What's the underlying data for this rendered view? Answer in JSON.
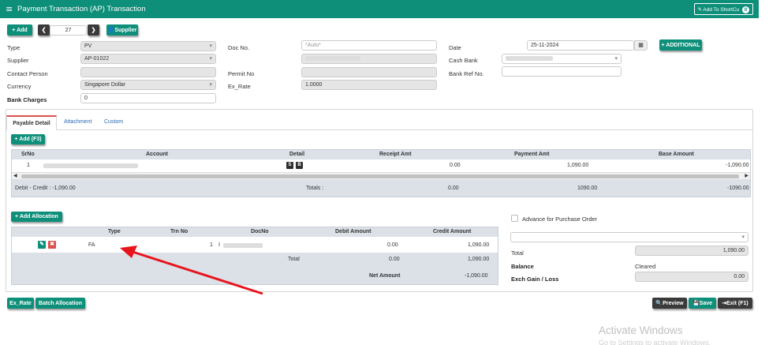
{
  "header": {
    "title": "Payment Transaction (AP) Transaction",
    "shortcut_label": "Add To ShortCu",
    "shortcut_badge": "0"
  },
  "toolbar": {
    "add_label": "+ Add",
    "record_no": "27",
    "supplier_label": "Supplier",
    "additional_label": "+ ADDITIONAL"
  },
  "form": {
    "type_label": "Type",
    "type_value": "PV",
    "supplier_label": "Supplier",
    "supplier_value": "AP-01022",
    "contact_label": "Contact Person",
    "contact_value": "",
    "currency_label": "Currency",
    "currency_value": "Singapore Dollar",
    "bank_charges_label": "Bank Charges",
    "bank_charges_value": "0",
    "docno_label": "Doc No.",
    "docno_placeholder": "*Auto*",
    "permit_label": "Permit No",
    "permit_value": "",
    "exrate_label": "Ex_Rate",
    "exrate_value": "1.0000",
    "date_label": "Date",
    "date_value": "25-11-2024",
    "cashbank_label": "Cash Bank",
    "bankref_label": "Bank Ref No.",
    "bankref_value": ""
  },
  "tabs": [
    {
      "label": "Payable Detail"
    },
    {
      "label": "Attachment"
    },
    {
      "label": "Custom"
    }
  ],
  "detail": {
    "add_label": "+ Add (F3)",
    "columns": [
      "SrNo",
      "Account",
      "Detail",
      "Receipt Amt",
      "Payment Amt",
      "Base Amount"
    ],
    "rows": [
      {
        "srno": "1",
        "detail_s": "S",
        "detail_b": "B",
        "receipt": "0.00",
        "payment": "1,090.00",
        "base": "-1,090.00"
      }
    ],
    "summary": {
      "debit_credit": "Debit - Credit : -1,090.00",
      "totals_label": "Totals :",
      "receipt": "0.00",
      "payment": "1090.00",
      "base": "-1090.00"
    }
  },
  "allocation": {
    "add_label": "+ Add Allocation",
    "columns": [
      "Type",
      "Trn No",
      "DocNo",
      "Debit Amount",
      "Credit Amount"
    ],
    "rows": [
      {
        "type": "FA",
        "trn_no": "1",
        "docno": "I",
        "debit": "0.00",
        "credit": "1,090.00"
      }
    ],
    "total_label": "Total",
    "total_debit": "0.00",
    "total_credit": "1,090.00",
    "net_label": "Net Amount",
    "net_value": "-1,090.00"
  },
  "side": {
    "advance_label": "Advance for Purchase Order",
    "total_label": "Total",
    "total_value": "1,090.00",
    "balance_label": "Balance",
    "balance_value": "Cleared",
    "exch_label": "Exch Gain / Loss",
    "exch_value": "0.00"
  },
  "footer": {
    "exrate_label": "Ex_Rate",
    "batch_label": "Batch Allocation",
    "preview_label": "Preview",
    "save_label": "Save",
    "exit_label": "Exit (F1)"
  },
  "watermark": {
    "line1": "Activate Windows",
    "line2": "Go to Settings to activate Windows."
  },
  "colors": {
    "brand": "#0e8f7a",
    "arrow": "#e8141c",
    "active_tab": "#d9534f",
    "link": "#2a6bb4"
  }
}
